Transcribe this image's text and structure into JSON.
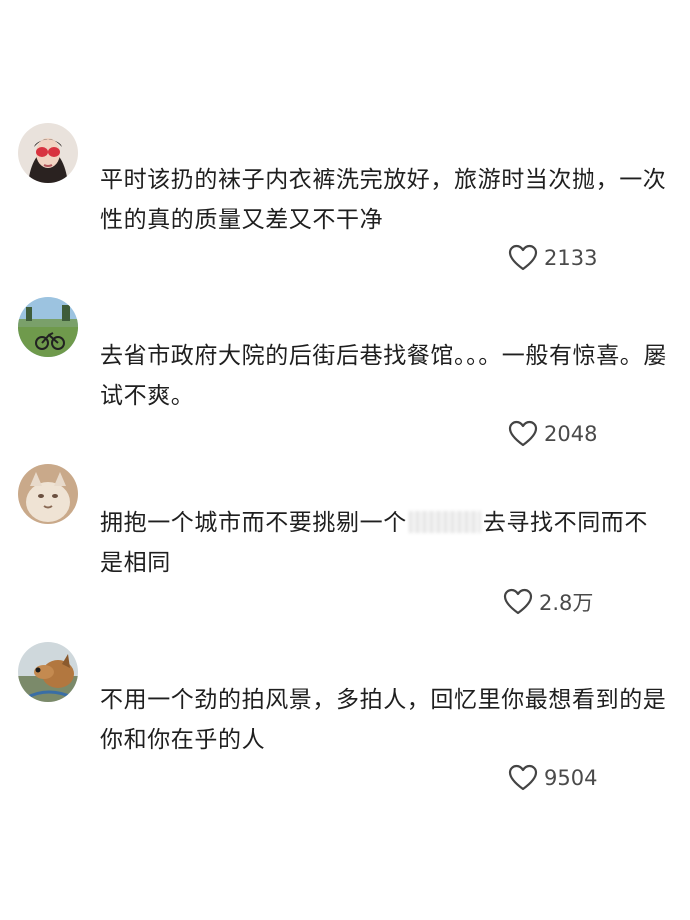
{
  "comments": [
    {
      "text": "平时该扔的袜子内衣裤洗完放好，旅游时当次抛，一次性的真的质量又差又不干净",
      "likes": "2133"
    },
    {
      "text": "去省市政府大院的后街后巷找餐馆。。。一般有惊喜。屡试不爽。",
      "likes": "2048"
    },
    {
      "text_before": "拥抱一个城市而不要挑剔一个",
      "text_after": "去寻找不同而不是相同",
      "likes": "2.8万"
    },
    {
      "text": "不用一个劲的拍风景，多拍人，回忆里你最想看到的是你和你在乎的人",
      "likes": "9504"
    }
  ],
  "icons": {
    "like": "heart-outline-icon"
  },
  "colors": {
    "text": "#1f1f1f",
    "count": "#4a4a4a",
    "background": "#ffffff"
  }
}
